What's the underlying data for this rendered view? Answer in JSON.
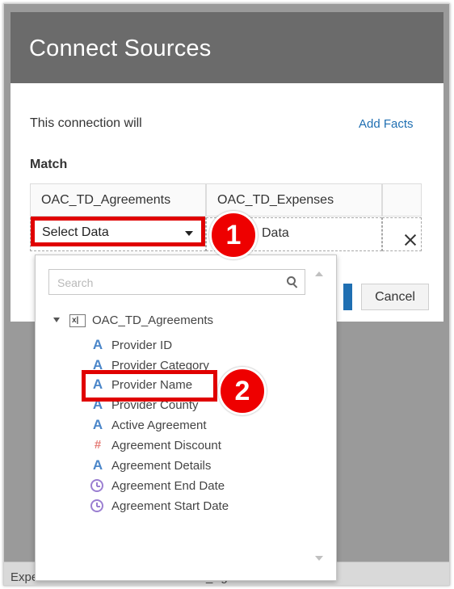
{
  "dialog": {
    "title": "Connect Sources",
    "connection_text": "This connection will",
    "add_facts_label": "Add Facts",
    "match_label": "Match",
    "columns": [
      "OAC_TD_Agreements",
      "OAC_TD_Expenses"
    ],
    "left_select_value": "Select Data",
    "right_select_value": "Data",
    "cancel_label": "Cancel"
  },
  "dropdown": {
    "search_placeholder": "Search",
    "root_label": "OAC_TD_Agreements",
    "items": [
      {
        "label": "Provider ID",
        "icon": "text-attribute-icon"
      },
      {
        "label": "Provider Category",
        "icon": "text-attribute-icon"
      },
      {
        "label": "Provider Name",
        "icon": "text-attribute-icon"
      },
      {
        "label": "Provider County",
        "icon": "text-attribute-icon"
      },
      {
        "label": "Active Agreement",
        "icon": "text-attribute-icon"
      },
      {
        "label": "Agreement Discount",
        "icon": "measure-icon"
      },
      {
        "label": "Agreement Details",
        "icon": "text-attribute-icon"
      },
      {
        "label": "Agreement End Date",
        "icon": "date-icon"
      },
      {
        "label": "Agreement Start Date",
        "icon": "date-icon"
      }
    ]
  },
  "background": {
    "strip_left": "Expenses",
    "strip_right": "TD_Agreements"
  },
  "annotations": {
    "step1": "1",
    "step2": "2"
  },
  "colors": {
    "header": "#6b6b6b",
    "accent_link": "#1f6fb2",
    "callout_red": "#ee0000"
  }
}
